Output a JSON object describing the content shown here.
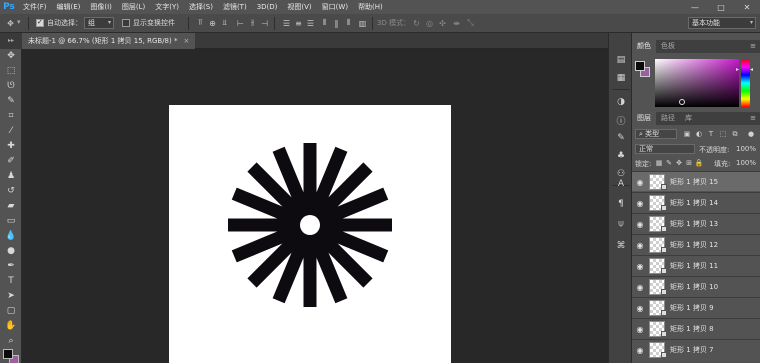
{
  "app": {
    "logo": "Ps"
  },
  "menu": [
    "文件(F)",
    "编辑(E)",
    "图像(I)",
    "图层(L)",
    "文字(Y)",
    "选择(S)",
    "滤镜(T)",
    "3D(D)",
    "视图(V)",
    "窗口(W)",
    "帮助(H)"
  ],
  "window_controls": {
    "minimize": "—",
    "maximize": "□",
    "close": "✕"
  },
  "options": {
    "auto_select_label": "自动选择：",
    "auto_select_checked": true,
    "auto_select_value": "组",
    "transform_label": "显示变换控件",
    "transform_checked": false,
    "mode_3d_label": "3D 模式：",
    "workspace": "基本功能"
  },
  "document_tab": {
    "title": "未标题-1 @ 66.7% (矩形 1 拷贝 15, RGB/8) *",
    "close": "×"
  },
  "color_panel": {
    "tabs": [
      "颜色",
      "色板"
    ],
    "active": 0,
    "foreground": "#0b0b0b",
    "background": "#9c5fa0",
    "hue": "#c518cb"
  },
  "layers_panel": {
    "tabs": [
      "图层",
      "路径",
      "库"
    ],
    "active": 0,
    "filter_kind": "类型",
    "blend_mode": "正常",
    "opacity_label": "不透明度:",
    "opacity_value": "100%",
    "lock_label": "锁定:",
    "fill_label": "填充:",
    "fill_value": "100%",
    "layers": [
      {
        "name": "矩形 1 拷贝 15",
        "visible": true,
        "selected": true
      },
      {
        "name": "矩形 1 拷贝 14",
        "visible": true,
        "selected": false
      },
      {
        "name": "矩形 1 拷贝 13",
        "visible": true,
        "selected": false
      },
      {
        "name": "矩形 1 拷贝 12",
        "visible": true,
        "selected": false
      },
      {
        "name": "矩形 1 拷贝 11",
        "visible": true,
        "selected": false
      },
      {
        "name": "矩形 1 拷贝 10",
        "visible": true,
        "selected": false
      },
      {
        "name": "矩形 1 拷贝 9",
        "visible": true,
        "selected": false
      },
      {
        "name": "矩形 1 拷贝 8",
        "visible": true,
        "selected": false
      },
      {
        "name": "矩形 1 拷贝 7",
        "visible": true,
        "selected": false
      }
    ]
  },
  "artwork": {
    "ray_count": 16,
    "ray_color": "#0d0b10"
  }
}
